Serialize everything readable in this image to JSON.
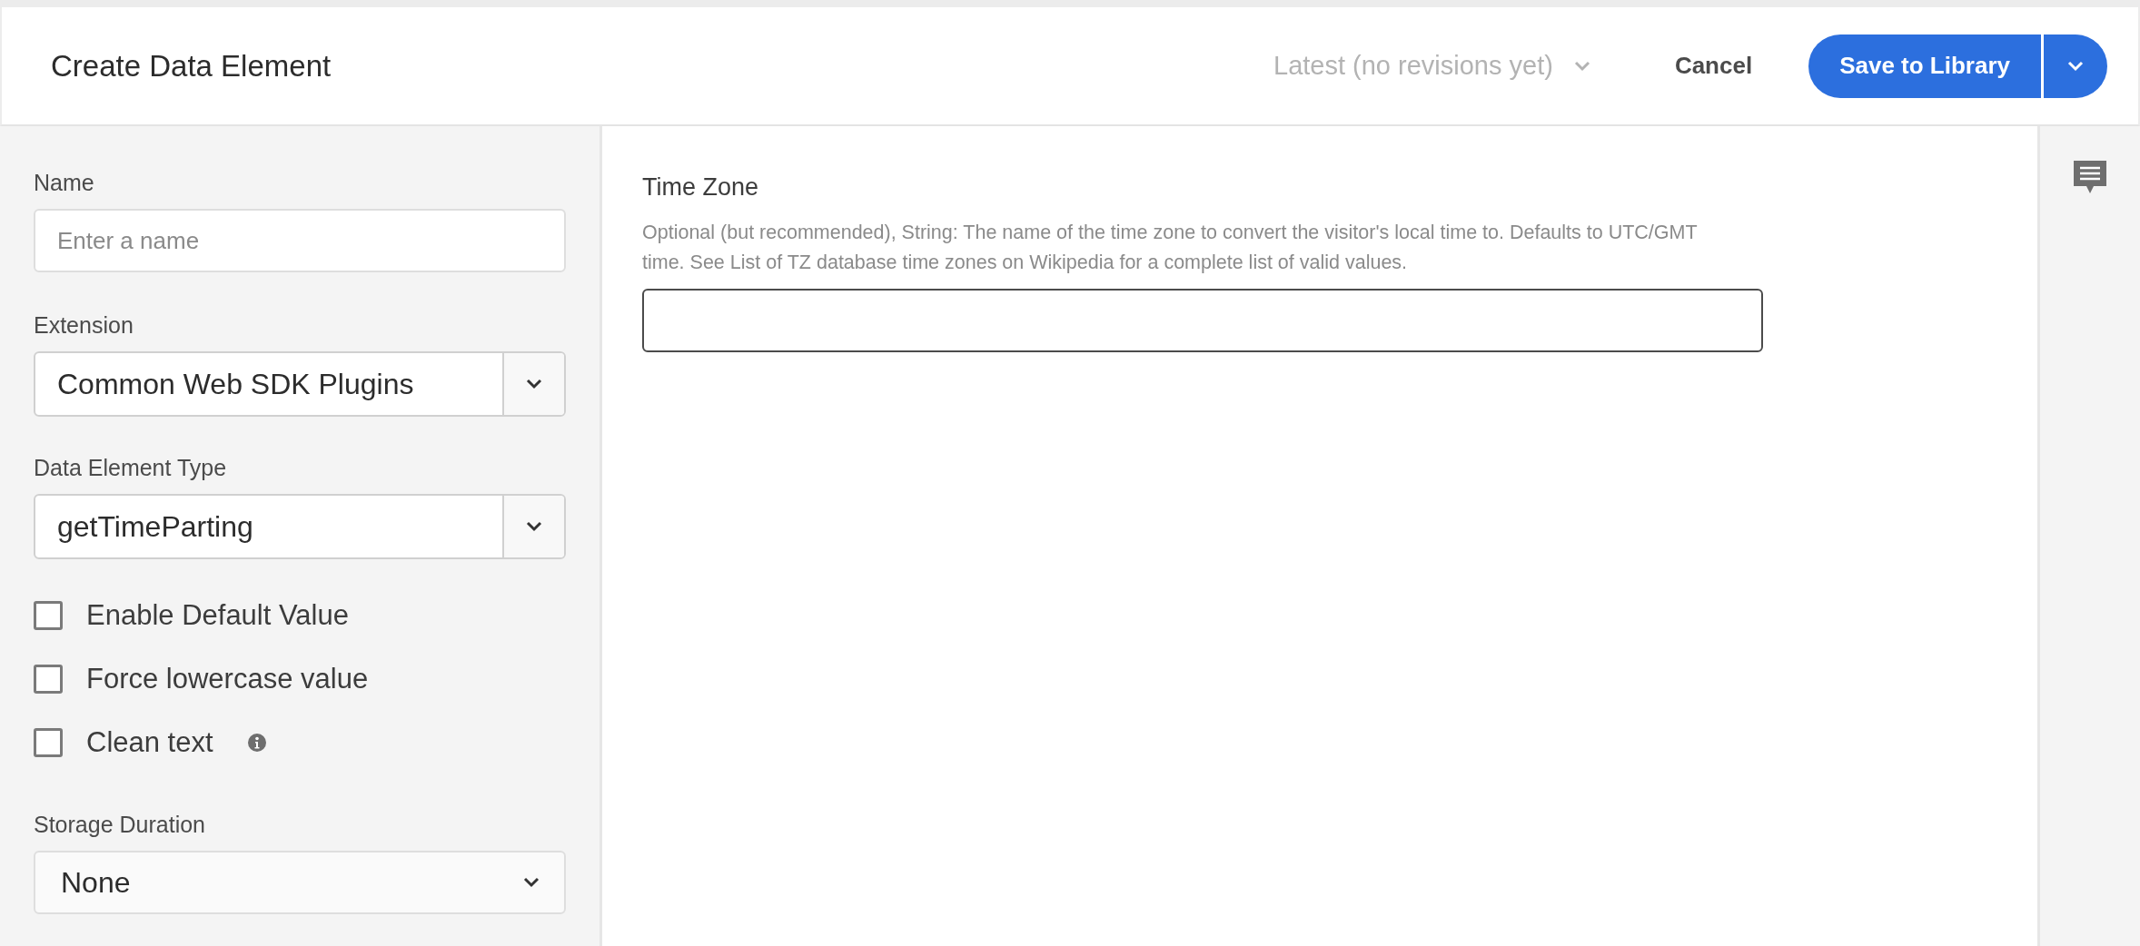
{
  "header": {
    "title": "Create Data Element",
    "revision": {
      "label": "Latest (no revisions yet)",
      "disabled": true
    },
    "cancel": "Cancel",
    "save": "Save to Library"
  },
  "sidebar": {
    "fields": [
      {
        "kind": "text",
        "label": "Name",
        "placeholder": "Enter a name"
      },
      {
        "kind": "combo",
        "label": "Extension",
        "value": "Common Web SDK Plugins"
      },
      {
        "kind": "combo",
        "label": "Data Element Type",
        "value": "getTimeParting"
      },
      {
        "kind": "checkbox",
        "label": "Enable Default Value",
        "checked": false,
        "info": false
      },
      {
        "kind": "checkbox",
        "label": "Force lowercase value",
        "checked": false,
        "info": false
      },
      {
        "kind": "checkbox",
        "label": "Clean text",
        "checked": false,
        "info": true
      },
      {
        "kind": "select",
        "label": "Storage Duration",
        "value": "None"
      }
    ]
  },
  "main": {
    "label": "Time Zone",
    "description": "Optional (but recommended), String: The name of the time zone to convert the visitor's local time to. Defaults to UTC/GMT time. See List of TZ database time zones on Wikipedia for a complete list of valid values."
  }
}
